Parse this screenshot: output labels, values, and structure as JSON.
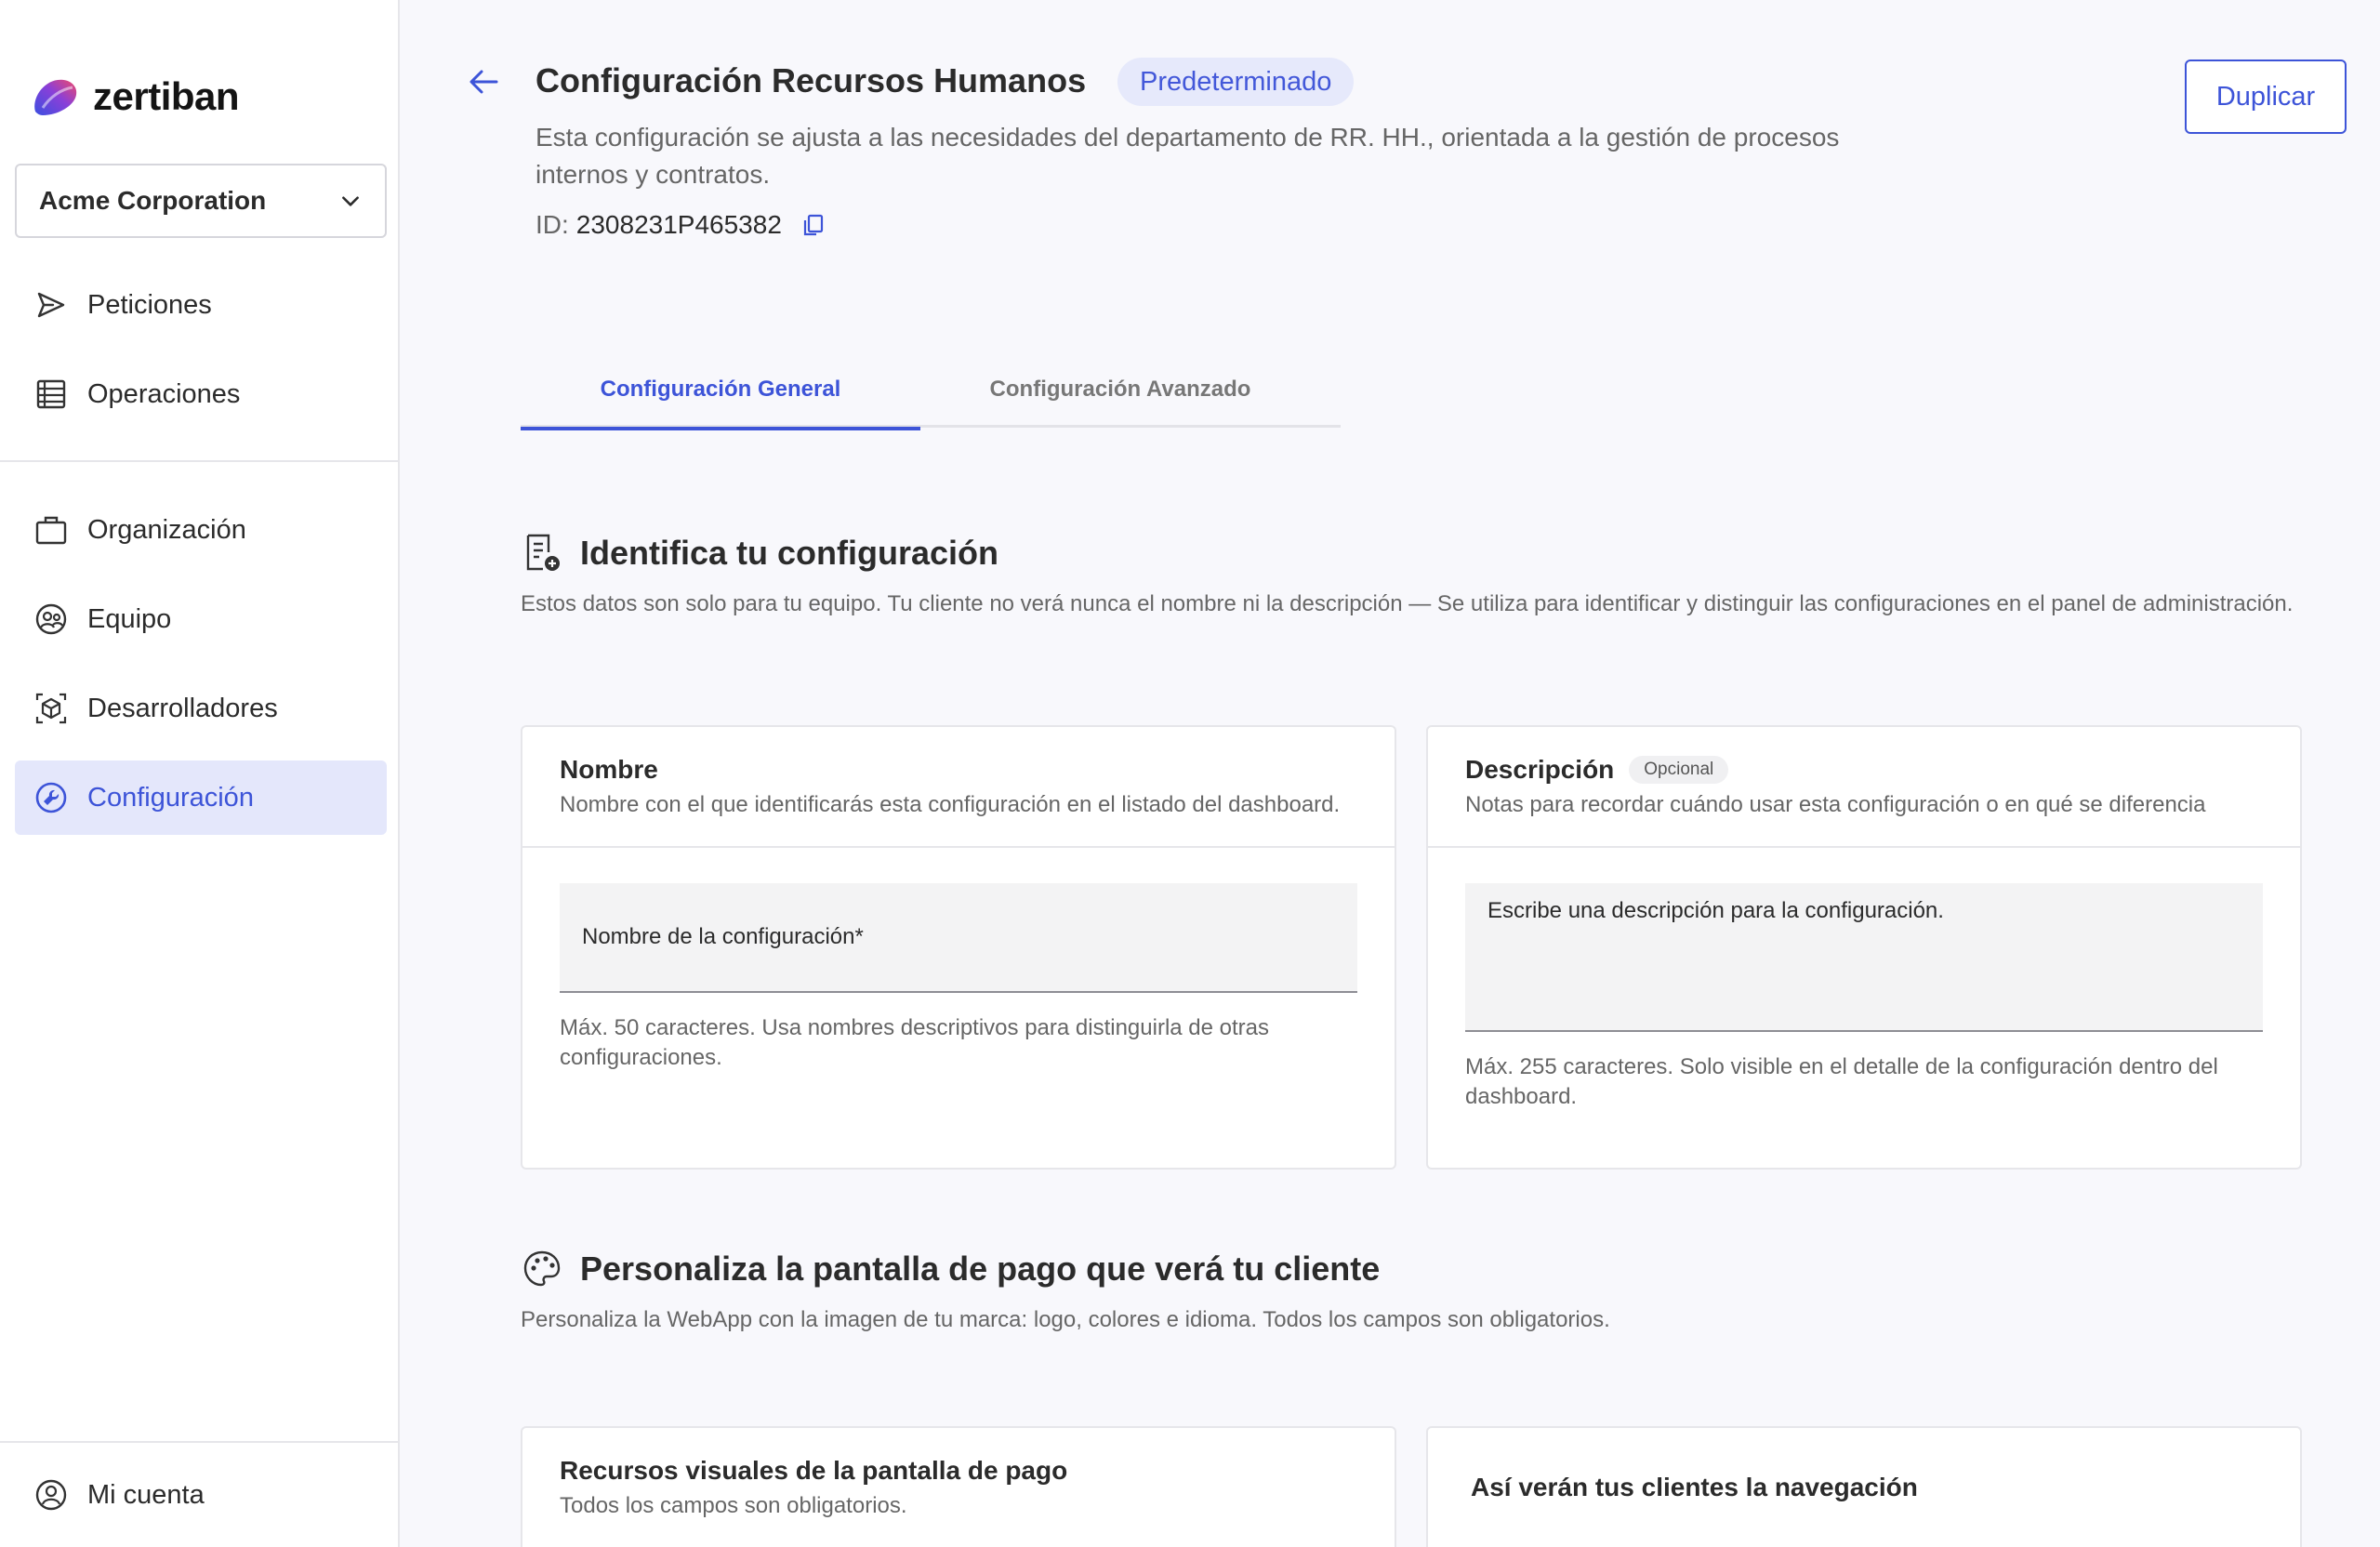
{
  "brand": {
    "name": "zertiban"
  },
  "org_selector": {
    "value": "Acme Corporation"
  },
  "nav": {
    "items": [
      {
        "label": "Peticiones",
        "icon": "send-icon"
      },
      {
        "label": "Operaciones",
        "icon": "list-icon"
      },
      {
        "label": "Organización",
        "icon": "briefcase-icon"
      },
      {
        "label": "Equipo",
        "icon": "team-icon"
      },
      {
        "label": "Desarrolladores",
        "icon": "cube-icon"
      },
      {
        "label": "Configuración",
        "icon": "wrench-icon",
        "active": true
      }
    ],
    "account": {
      "label": "Mi cuenta",
      "icon": "user-circle-icon"
    }
  },
  "header": {
    "title": "Configuración Recursos Humanos",
    "badge": "Predeterminado",
    "description": "Esta configuración se ajusta a las necesidades del departamento de RR. HH., orientada a la gestión de procesos internos y contratos.",
    "id_label": "ID:",
    "id_value": "2308231P465382",
    "duplicate_label": "Duplicar"
  },
  "tabs": [
    {
      "label": "Configuración General",
      "active": true
    },
    {
      "label": "Configuración Avanzado",
      "active": false
    }
  ],
  "identify": {
    "title": "Identifica tu configuración",
    "subtitle": "Estos datos son solo para tu equipo. Tu cliente no verá nunca el nombre ni la descripción — Se utiliza para identificar y distinguir las configuraciones en el panel de administración.",
    "name_card": {
      "title": "Nombre",
      "description": "Nombre con el que identificarás esta configuración en el listado del dashboard.",
      "placeholder": "Nombre de la configuración*",
      "help": "Máx. 50 caracteres. Usa nombres descriptivos para distinguirla de otras configuraciones."
    },
    "desc_card": {
      "title": "Descripción",
      "optional": "Opcional",
      "description": "Notas para recordar cuándo usar esta configuración o en qué se diferencia",
      "placeholder": "Escribe una descripción para la configuración.",
      "help": "Máx. 255 caracteres. Solo visible en el detalle de la configuración dentro del dashboard."
    }
  },
  "customize": {
    "title": "Personaliza la pantalla de pago que verá tu cliente",
    "subtitle": "Personaliza la WebApp con la imagen de tu marca: logo, colores e idioma. Todos los campos son obligatorios.",
    "visual_card": {
      "title": "Recursos visuales de la pantalla de pago",
      "description": "Todos los campos son obligatorios."
    },
    "preview_card": {
      "title": "Así verán tus clientes la navegación"
    }
  },
  "colors": {
    "accent": "#3d54d8",
    "active_bg": "#e4e7fb",
    "badge_bg": "#e6e9fb"
  }
}
